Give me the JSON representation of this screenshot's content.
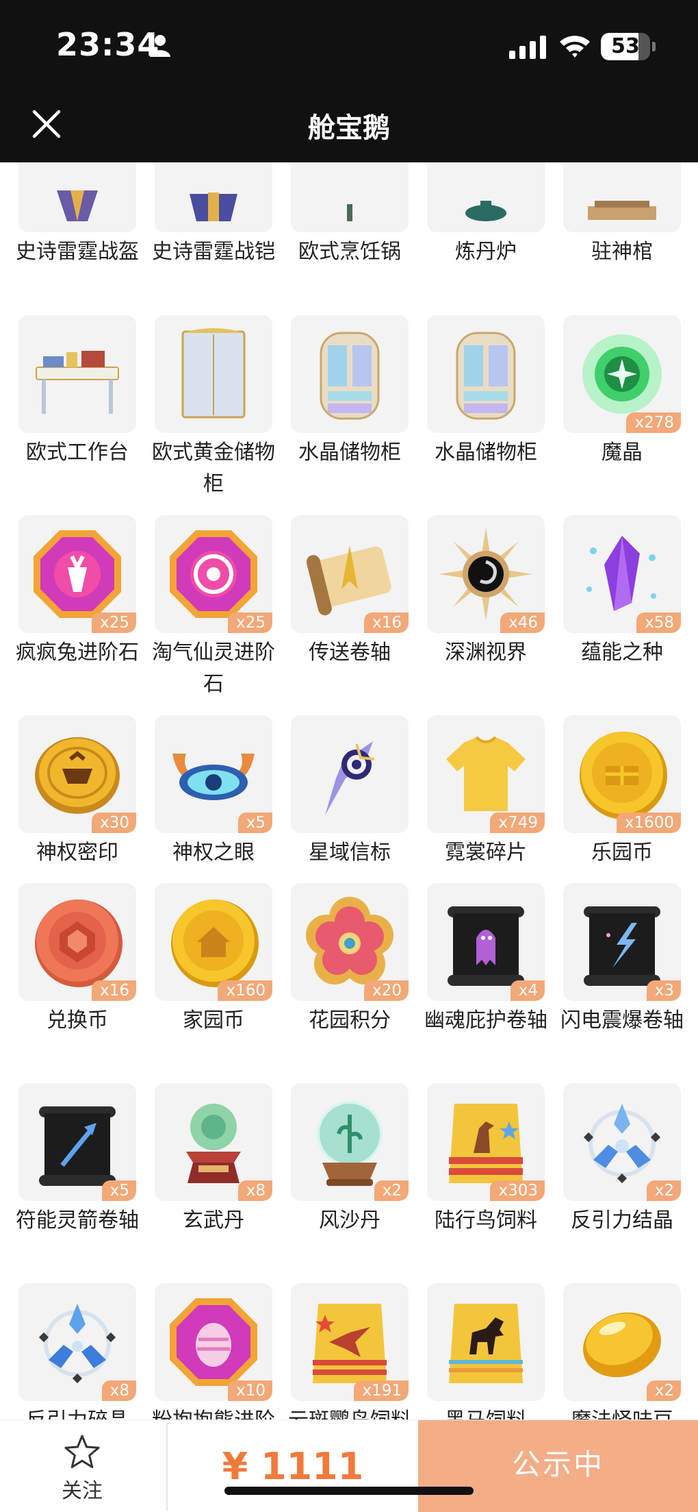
{
  "status_bar": {
    "time": "23:34",
    "battery": "53"
  },
  "nav": {
    "title": "舱宝鹅"
  },
  "items": [
    {
      "label": "史诗雷霆战盔",
      "count": "",
      "icon": "helmet-icon"
    },
    {
      "label": "史诗雷霆战铠",
      "count": "",
      "icon": "armor-icon"
    },
    {
      "label": "欧式烹饪锅",
      "count": "",
      "icon": "cooking-pot-icon"
    },
    {
      "label": "炼丹炉",
      "count": "",
      "icon": "alchemy-furnace-icon"
    },
    {
      "label": "驻神棺",
      "count": "",
      "icon": "coffin-icon"
    },
    {
      "label": "欧式工作台",
      "count": "",
      "icon": "workbench-icon"
    },
    {
      "label": "欧式黄金储物柜",
      "count": "",
      "icon": "wardrobe-icon"
    },
    {
      "label": "水晶储物柜",
      "count": "",
      "icon": "crystal-cabinet-icon"
    },
    {
      "label": "水晶储物柜",
      "count": "",
      "icon": "crystal-cabinet-icon"
    },
    {
      "label": "魔晶",
      "count": "x278",
      "icon": "green-orb-icon"
    },
    {
      "label": "疯疯兔进阶石",
      "count": "x25",
      "icon": "gem-rabbit-icon"
    },
    {
      "label": "淘气仙灵进阶石",
      "count": "x25",
      "icon": "gem-fairy-icon"
    },
    {
      "label": "传送卷轴",
      "count": "x16",
      "icon": "teleport-scroll-icon"
    },
    {
      "label": "深渊视界",
      "count": "x46",
      "icon": "abyss-sun-icon"
    },
    {
      "label": "蕴能之种",
      "count": "x58",
      "icon": "purple-crystal-icon"
    },
    {
      "label": "神权密印",
      "count": "x30",
      "icon": "gold-seal-icon"
    },
    {
      "label": "神权之眼",
      "count": "x5",
      "icon": "winged-eye-icon"
    },
    {
      "label": "星域信标",
      "count": "",
      "icon": "star-beacon-icon"
    },
    {
      "label": "霓裳碎片",
      "count": "x749",
      "icon": "shirt-icon"
    },
    {
      "label": "乐园币",
      "count": "x1600",
      "icon": "gold-coin-icon"
    },
    {
      "label": "兑换币",
      "count": "x16",
      "icon": "red-coin-icon"
    },
    {
      "label": "家园币",
      "count": "x160",
      "icon": "home-coin-icon"
    },
    {
      "label": "花园积分",
      "count": "x20",
      "icon": "flower-badge-icon"
    },
    {
      "label": "幽魂庇护卷轴",
      "count": "x4",
      "icon": "ghost-scroll-icon"
    },
    {
      "label": "闪电震爆卷轴",
      "count": "x3",
      "icon": "lightning-scroll-icon"
    },
    {
      "label": "符能灵箭卷轴",
      "count": "x5",
      "icon": "arrow-scroll-icon"
    },
    {
      "label": "玄武丹",
      "count": "x8",
      "icon": "green-pill-altar-icon"
    },
    {
      "label": "风沙丹",
      "count": "x2",
      "icon": "crystal-ball-icon"
    },
    {
      "label": "陆行鸟饲料",
      "count": "x303",
      "icon": "bird-feed-bag-icon"
    },
    {
      "label": "反引力结晶",
      "count": "x2",
      "icon": "antigravity-crystal-icon"
    },
    {
      "label": "反引力碎晶",
      "count": "x8",
      "icon": "antigravity-shard-icon"
    },
    {
      "label": "粉抱抱熊进阶石",
      "count": "x10",
      "icon": "gem-egg-icon"
    },
    {
      "label": "云斑鹦鸟饲料",
      "count": "x191",
      "icon": "parrot-feed-bag-icon"
    },
    {
      "label": "黑马饲料",
      "count": "",
      "icon": "horse-feed-bag-icon"
    },
    {
      "label": "魔法怪味豆",
      "count": "x2",
      "icon": "golden-bean-icon"
    }
  ],
  "bottom": {
    "follow_label": "关注",
    "price": "¥ 1111",
    "status": "公示中"
  }
}
